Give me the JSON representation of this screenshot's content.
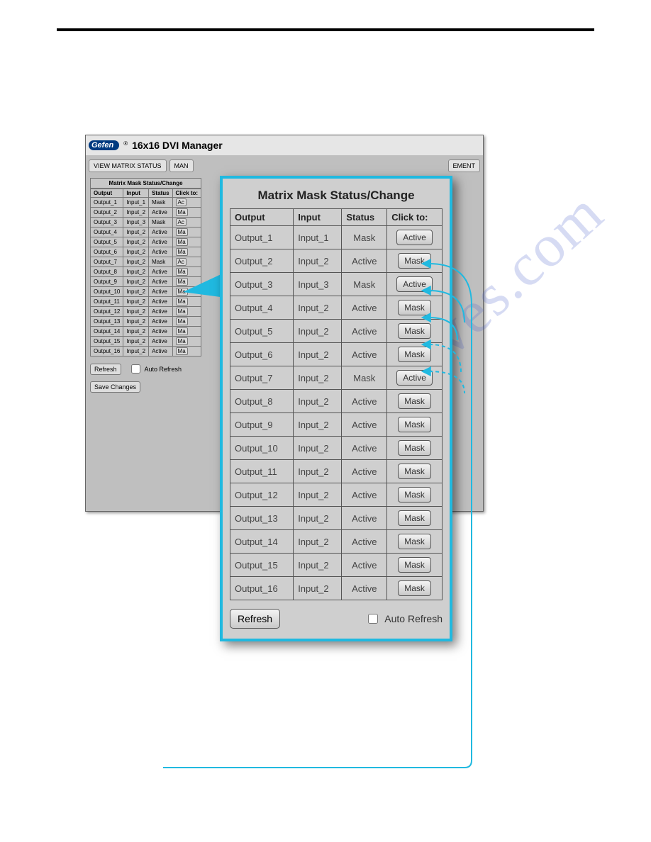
{
  "brand": "Gefen",
  "app_title": "16x16 DVI Manager",
  "toolbar": {
    "view_matrix": "VIEW MATRIX STATUS",
    "man_prefix": "MAN",
    "right_suffix": "EMENT"
  },
  "mini_panel": {
    "caption": "Matrix Mask Status/Change",
    "headers": [
      "Output",
      "Input",
      "Status",
      "Click to:"
    ],
    "rows": [
      {
        "output": "Output_1",
        "input": "Input_1",
        "status": "Mask",
        "btn": "Active"
      },
      {
        "output": "Output_2",
        "input": "Input_2",
        "status": "Active",
        "btn": "Mask"
      },
      {
        "output": "Output_3",
        "input": "Input_3",
        "status": "Mask",
        "btn": "Active"
      },
      {
        "output": "Output_4",
        "input": "Input_2",
        "status": "Active",
        "btn": "Mask"
      },
      {
        "output": "Output_5",
        "input": "Input_2",
        "status": "Active",
        "btn": "Mask"
      },
      {
        "output": "Output_6",
        "input": "Input_2",
        "status": "Active",
        "btn": "Mask"
      },
      {
        "output": "Output_7",
        "input": "Input_2",
        "status": "Mask",
        "btn": "Active"
      },
      {
        "output": "Output_8",
        "input": "Input_2",
        "status": "Active",
        "btn": "Mask"
      },
      {
        "output": "Output_9",
        "input": "Input_2",
        "status": "Active",
        "btn": "Mask"
      },
      {
        "output": "Output_10",
        "input": "Input_2",
        "status": "Active",
        "btn": "Mask"
      },
      {
        "output": "Output_11",
        "input": "Input_2",
        "status": "Active",
        "btn": "Mask"
      },
      {
        "output": "Output_12",
        "input": "Input_2",
        "status": "Active",
        "btn": "Mask"
      },
      {
        "output": "Output_13",
        "input": "Input_2",
        "status": "Active",
        "btn": "Mask"
      },
      {
        "output": "Output_14",
        "input": "Input_2",
        "status": "Active",
        "btn": "Mask"
      },
      {
        "output": "Output_15",
        "input": "Input_2",
        "status": "Active",
        "btn": "Mask"
      },
      {
        "output": "Output_16",
        "input": "Input_2",
        "status": "Active",
        "btn": "Mask"
      }
    ],
    "refresh": "Refresh",
    "auto_refresh": "Auto Refresh",
    "save_changes": "Save Changes"
  },
  "fg_panel": {
    "title": "Matrix Mask Status/Change",
    "headers": [
      "Output",
      "Input",
      "Status",
      "Click to:"
    ],
    "rows": [
      {
        "output": "Output_1",
        "input": "Input_1",
        "status": "Mask",
        "btn": "Active"
      },
      {
        "output": "Output_2",
        "input": "Input_2",
        "status": "Active",
        "btn": "Mask"
      },
      {
        "output": "Output_3",
        "input": "Input_3",
        "status": "Mask",
        "btn": "Active"
      },
      {
        "output": "Output_4",
        "input": "Input_2",
        "status": "Active",
        "btn": "Mask"
      },
      {
        "output": "Output_5",
        "input": "Input_2",
        "status": "Active",
        "btn": "Mask"
      },
      {
        "output": "Output_6",
        "input": "Input_2",
        "status": "Active",
        "btn": "Mask"
      },
      {
        "output": "Output_7",
        "input": "Input_2",
        "status": "Mask",
        "btn": "Active"
      },
      {
        "output": "Output_8",
        "input": "Input_2",
        "status": "Active",
        "btn": "Mask"
      },
      {
        "output": "Output_9",
        "input": "Input_2",
        "status": "Active",
        "btn": "Mask"
      },
      {
        "output": "Output_10",
        "input": "Input_2",
        "status": "Active",
        "btn": "Mask"
      },
      {
        "output": "Output_11",
        "input": "Input_2",
        "status": "Active",
        "btn": "Mask"
      },
      {
        "output": "Output_12",
        "input": "Input_2",
        "status": "Active",
        "btn": "Mask"
      },
      {
        "output": "Output_13",
        "input": "Input_2",
        "status": "Active",
        "btn": "Mask"
      },
      {
        "output": "Output_14",
        "input": "Input_2",
        "status": "Active",
        "btn": "Mask"
      },
      {
        "output": "Output_15",
        "input": "Input_2",
        "status": "Active",
        "btn": "Mask"
      },
      {
        "output": "Output_16",
        "input": "Input_2",
        "status": "Active",
        "btn": "Mask"
      }
    ],
    "refresh": "Refresh",
    "auto_refresh": "Auto Refresh"
  },
  "watermark": "manualshives.com"
}
